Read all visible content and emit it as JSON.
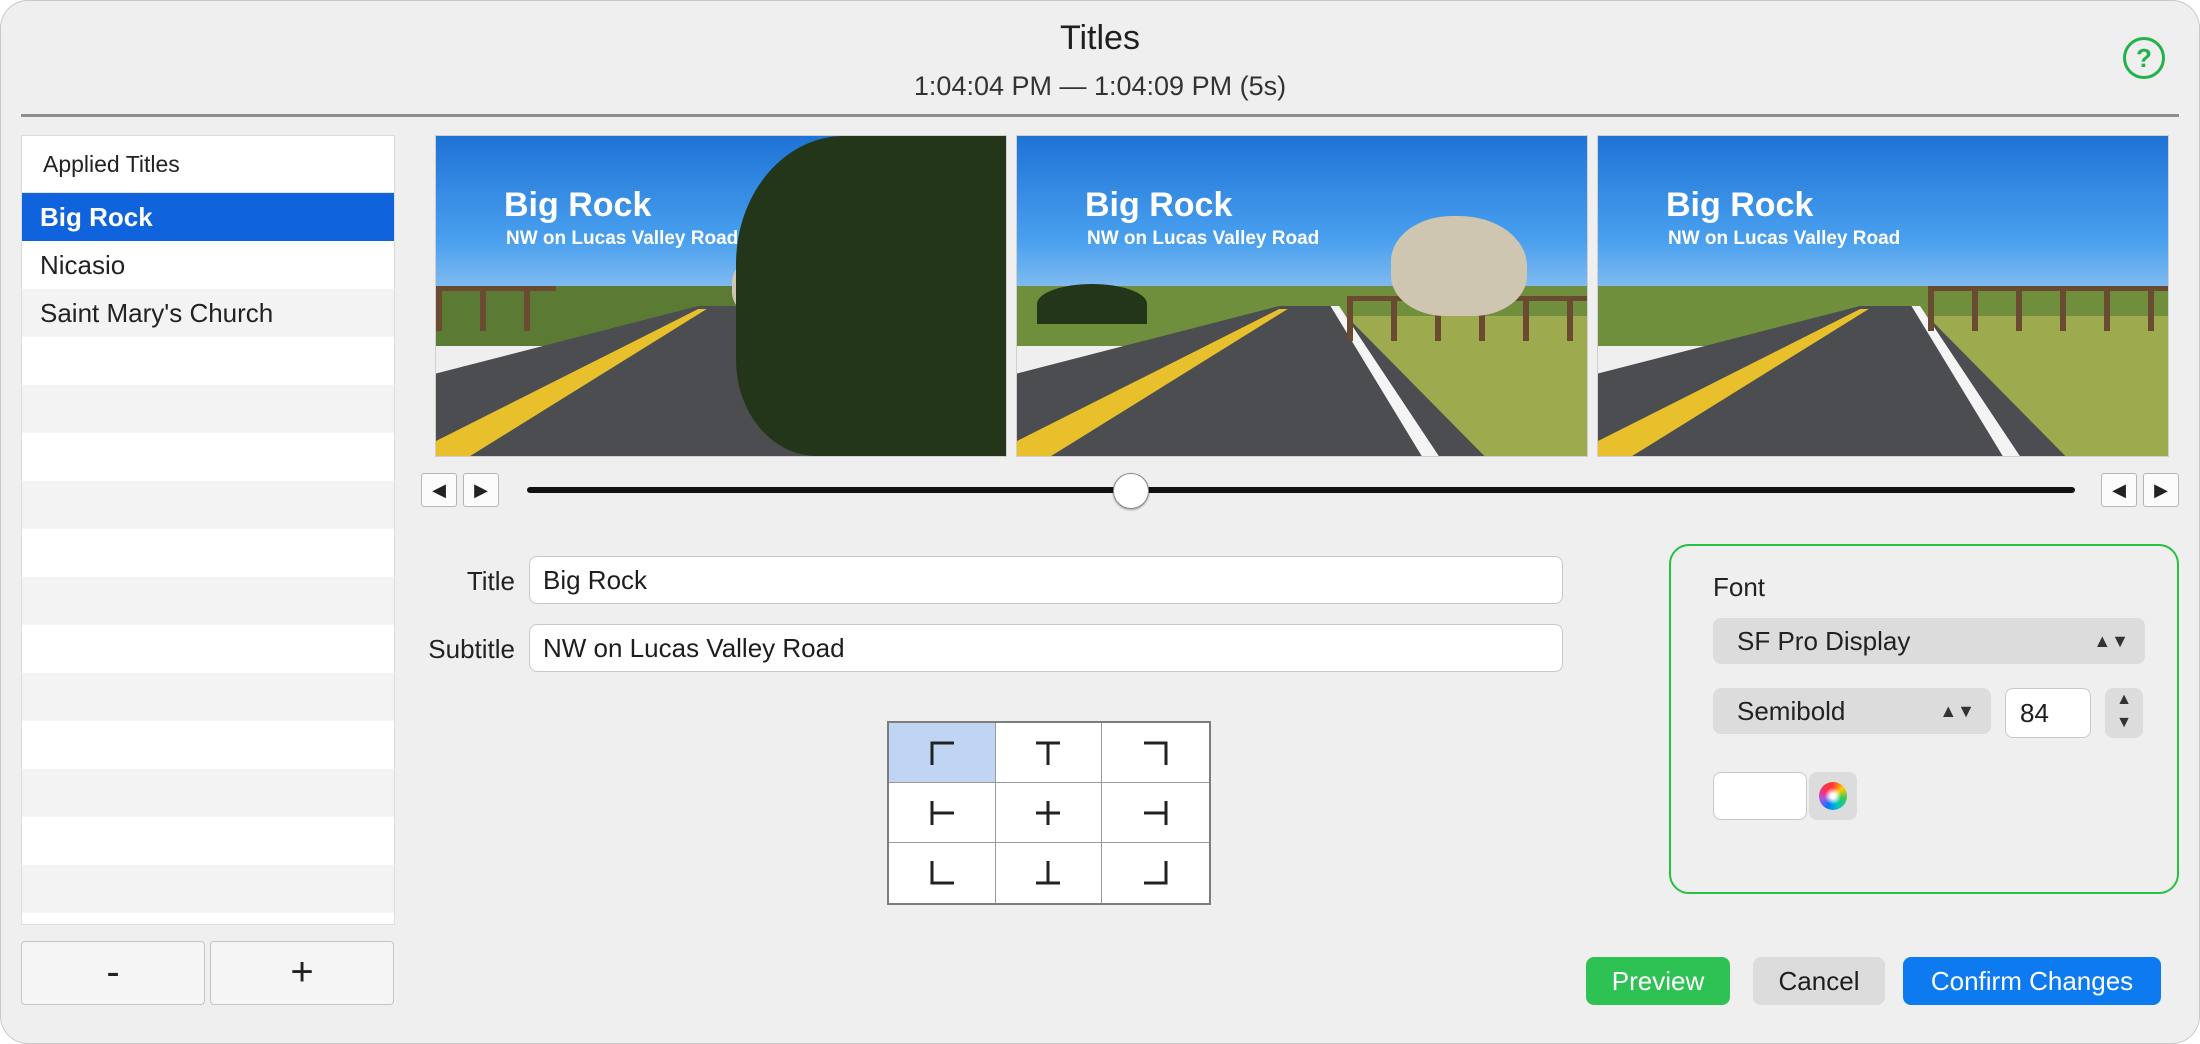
{
  "window": {
    "title": "Titles",
    "time_range": "1:04:04 PM — 1:04:09 PM (5s)"
  },
  "sidebar": {
    "header": "Applied Titles",
    "items": [
      {
        "label": "Big Rock",
        "selected": true
      },
      {
        "label": "Nicasio",
        "selected": false
      },
      {
        "label": "Saint Mary's Church",
        "selected": false
      }
    ],
    "remove_label": "-",
    "add_label": "+"
  },
  "thumbnails": [
    {
      "title": "Big Rock",
      "subtitle": "NW on Lucas Valley Road"
    },
    {
      "title": "Big Rock",
      "subtitle": "NW on Lucas Valley Road"
    },
    {
      "title": "Big Rock",
      "subtitle": "NW on Lucas Valley Road"
    }
  ],
  "scrubber": {
    "prev_symbol": "◀",
    "next_symbol": "▶",
    "position_fraction": 0.39
  },
  "fields": {
    "title_label": "Title",
    "title_value": "Big Rock",
    "subtitle_label": "Subtitle",
    "subtitle_value": "NW on Lucas Valley Road"
  },
  "position_grid": {
    "cells": [
      "top-left",
      "top-center",
      "top-right",
      "middle-left",
      "center",
      "middle-right",
      "bottom-left",
      "bottom-center",
      "bottom-right"
    ],
    "selected": "top-left"
  },
  "font_panel": {
    "label": "Font",
    "family": "SF Pro Display",
    "weight": "Semibold",
    "size": "84",
    "color": "#ffffff",
    "accent_border": "#28c040"
  },
  "buttons": {
    "preview": "Preview",
    "cancel": "Cancel",
    "confirm": "Confirm Changes"
  },
  "icons": {
    "help": "?",
    "remove": "minus-icon",
    "add": "plus-icon",
    "color_picker": "color-wheel-icon"
  }
}
